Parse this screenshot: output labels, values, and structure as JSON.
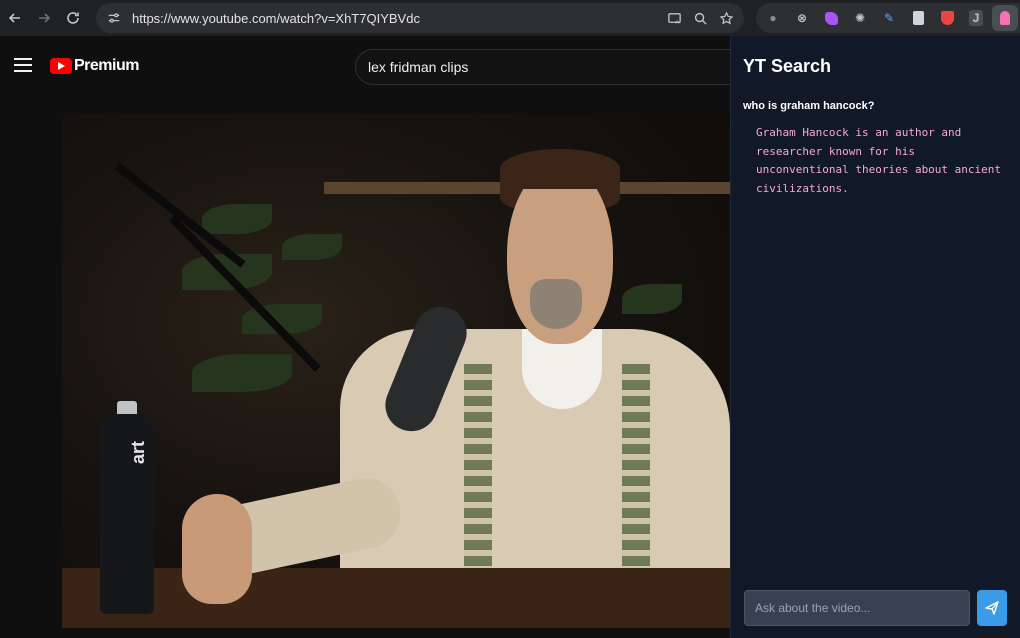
{
  "browser": {
    "url": "https://www.youtube.com/watch?v=XhT7QIYBVdc",
    "extension_initial": "J"
  },
  "youtube": {
    "logo_text": "Premium",
    "search_query": "lex fridman clips"
  },
  "video": {
    "bottle_label": "art"
  },
  "panel": {
    "title": "YT Search",
    "question": "who is graham hancock?",
    "answer": "Graham Hancock is an author and researcher known for his unconventional theories about ancient civilizations.",
    "input_placeholder": "Ask about the video..."
  },
  "colors": {
    "panel_bg": "#111827",
    "answer_text": "#f9a8d4",
    "send_button": "#3b9be8",
    "youtube_red": "#ff0000"
  }
}
